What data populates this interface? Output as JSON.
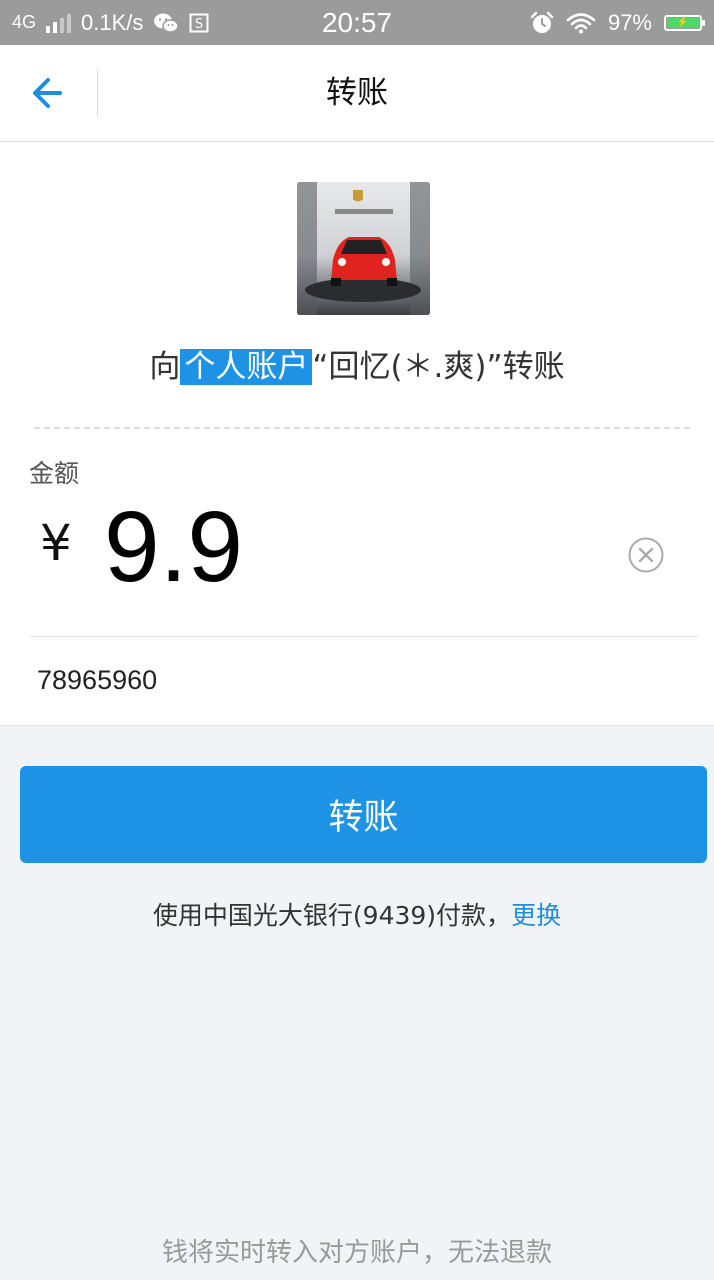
{
  "status_bar": {
    "network": "4G",
    "speed": "0.1K/s",
    "time": "20:57",
    "battery": "97%",
    "icons": [
      "signal-icon",
      "wechat-icon",
      "notification-s-icon",
      "alarm-icon",
      "wifi-icon",
      "battery-icon"
    ]
  },
  "nav": {
    "title": "转账",
    "back_icon": "back-arrow-icon"
  },
  "recipient": {
    "prefix": "向",
    "highlight": "个人账户",
    "name": "“回忆(＊.爽)”",
    "suffix": "转账",
    "avatar_brand": "PORSCHE"
  },
  "amount": {
    "label": "金额",
    "currency_symbol": "¥",
    "value": "9.9"
  },
  "note": {
    "value": "78965960"
  },
  "submit": {
    "label": "转账"
  },
  "payment": {
    "text": "使用中国光大银行(9439)付款，",
    "change_label": "更换"
  },
  "footer": {
    "text": "钱将实时转入对方账户，无法退款"
  },
  "colors": {
    "accent": "#1e93e6",
    "status_bar": "#9b9b9b",
    "battery_fill": "#4cd964",
    "background": "#f1f3f6"
  }
}
